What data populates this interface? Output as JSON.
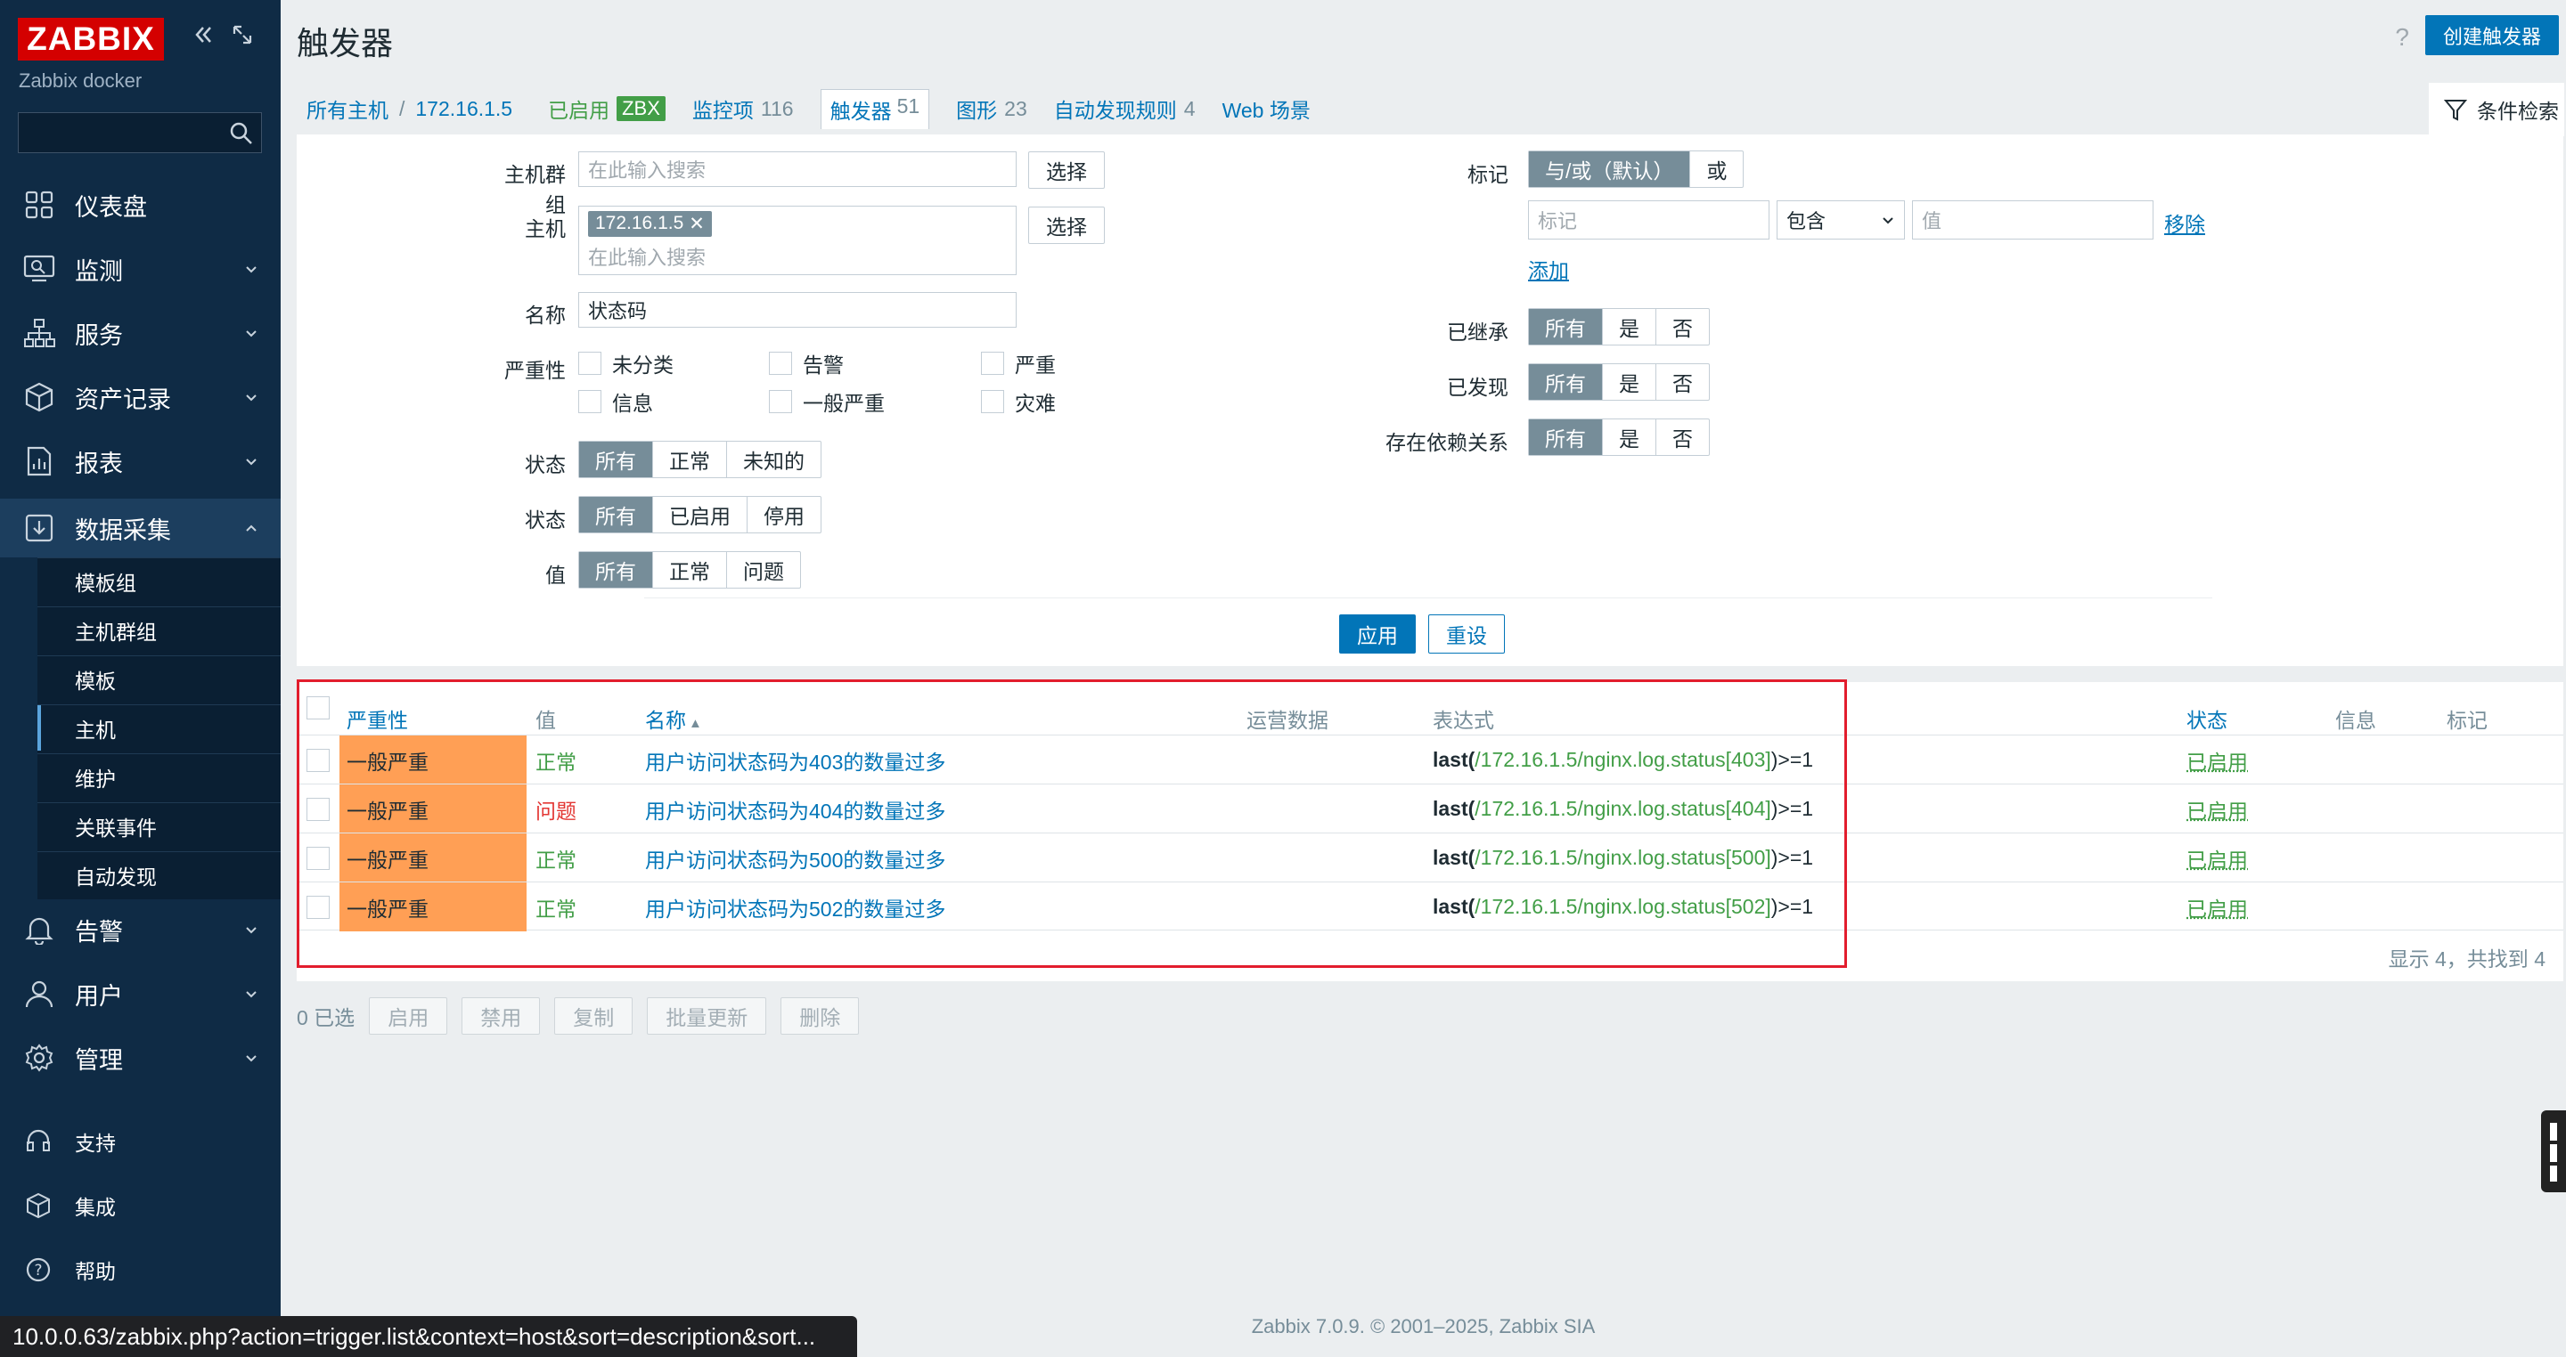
{
  "app": {
    "logo": "ZABBIX",
    "subtitle": "Zabbix docker"
  },
  "sidebar": {
    "search_placeholder": "",
    "items": [
      {
        "label": "仪表盘"
      },
      {
        "label": "监测"
      },
      {
        "label": "服务"
      },
      {
        "label": "资产记录"
      },
      {
        "label": "报表"
      },
      {
        "label": "数据采集"
      },
      {
        "label": "告警"
      },
      {
        "label": "用户"
      },
      {
        "label": "管理"
      }
    ],
    "sub_items": [
      {
        "label": "模板组"
      },
      {
        "label": "主机群组"
      },
      {
        "label": "模板"
      },
      {
        "label": "主机"
      },
      {
        "label": "维护"
      },
      {
        "label": "关联事件"
      },
      {
        "label": "自动发现"
      }
    ],
    "bottom": [
      {
        "label": "支持"
      },
      {
        "label": "集成"
      },
      {
        "label": "帮助"
      }
    ]
  },
  "header": {
    "title": "触发器",
    "help": "?",
    "create": "创建触发器"
  },
  "breadcrumb": {
    "all_hosts": "所有主机",
    "host": "172.16.1.5",
    "enabled": "已启用",
    "zbx": "ZBX",
    "items_label": "监控项",
    "items_count": "116",
    "triggers_label": "触发器",
    "triggers_count": "51",
    "graphs_label": "图形",
    "graphs_count": "23",
    "discovery_label": "自动发现规则",
    "discovery_count": "4",
    "web_label": "Web 场景"
  },
  "filter_tab": "条件检索",
  "filter": {
    "host_groups_label": "主机群组",
    "host_groups_placeholder": "在此输入搜索",
    "select": "选择",
    "host_label": "主机",
    "host_chip": "172.16.1.5",
    "host_placeholder": "在此输入搜索",
    "name_label": "名称",
    "name_value": "状态码",
    "severity_label": "严重性",
    "severities": [
      "未分类",
      "告警",
      "严重",
      "信息",
      "一般严重",
      "灾难"
    ],
    "state_label": "状态",
    "state_opts": [
      "所有",
      "正常",
      "未知的"
    ],
    "status_label": "状态",
    "status_opts": [
      "所有",
      "已启用",
      "停用"
    ],
    "value_label": "值",
    "value_opts": [
      "所有",
      "正常",
      "问题"
    ],
    "tags_label": "标记",
    "tags_opts": [
      "与/或（默认）",
      "或"
    ],
    "tag_placeholder": "标记",
    "tag_op": "包含",
    "tag_value_placeholder": "值",
    "remove": "移除",
    "add": "添加",
    "inherited_label": "已继承",
    "discovered_label": "已发现",
    "dependencies_label": "存在依赖关系",
    "yn_opts": [
      "所有",
      "是",
      "否"
    ],
    "apply": "应用",
    "reset": "重设"
  },
  "table": {
    "headers": {
      "severity": "严重性",
      "value": "值",
      "name": "名称",
      "sort": "▲",
      "opdata": "运营数据",
      "expression": "表达式",
      "status": "状态",
      "info": "信息",
      "tags": "标记"
    },
    "rows": [
      {
        "severity": "一般严重",
        "value": "正常",
        "name": "用户访问状态码为403的数量过多",
        "fn": "last(",
        "key": "/172.16.1.5/nginx.log.status[403]",
        "tail": ")>=1",
        "status": "已启用"
      },
      {
        "severity": "一般严重",
        "value": "问题",
        "name": "用户访问状态码为404的数量过多",
        "fn": "last(",
        "key": "/172.16.1.5/nginx.log.status[404]",
        "tail": ")>=1",
        "status": "已启用"
      },
      {
        "severity": "一般严重",
        "value": "正常",
        "name": "用户访问状态码为500的数量过多",
        "fn": "last(",
        "key": "/172.16.1.5/nginx.log.status[500]",
        "tail": ")>=1",
        "status": "已启用"
      },
      {
        "severity": "一般严重",
        "value": "正常",
        "name": "用户访问状态码为502的数量过多",
        "fn": "last(",
        "key": "/172.16.1.5/nginx.log.status[502]",
        "tail": ")>=1",
        "status": "已启用"
      }
    ],
    "footer": "显示 4，共找到 4"
  },
  "actions": {
    "selected": "0 已选",
    "buttons": [
      "启用",
      "禁用",
      "复制",
      "批量更新",
      "删除"
    ]
  },
  "copyright": "Zabbix 7.0.9. © 2001–2025, Zabbix SIA",
  "statusbar": "10.0.0.63/zabbix.php?action=trigger.list&context=host&sort=description&sort...",
  "colors": {
    "accent": "#0275b8",
    "sidebar": "#0f2b45",
    "severity_average": "#ff9f55",
    "ok": "#429e47",
    "problem": "#e33734",
    "highlight": "#e21d2d"
  }
}
